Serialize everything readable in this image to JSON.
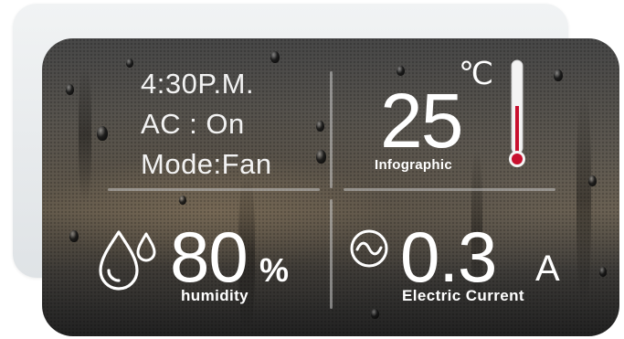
{
  "status": {
    "time": "4:30P.M.",
    "ac": "AC : On",
    "mode": "Mode:Fan"
  },
  "temperature": {
    "value": "25",
    "unit": "℃",
    "caption": "Infographic",
    "thermometer_icon": "thermometer-icon"
  },
  "humidity": {
    "value": "80",
    "unit": "%",
    "caption": "humidity",
    "icon": "water-drops-icon"
  },
  "current": {
    "value": "0.3",
    "unit": "A",
    "caption": "Electric Current",
    "icon": "ac-wave-icon"
  },
  "colors": {
    "text": "#ffffff",
    "thermometer_red": "#c8102e",
    "divider": "#c8c8c8"
  }
}
